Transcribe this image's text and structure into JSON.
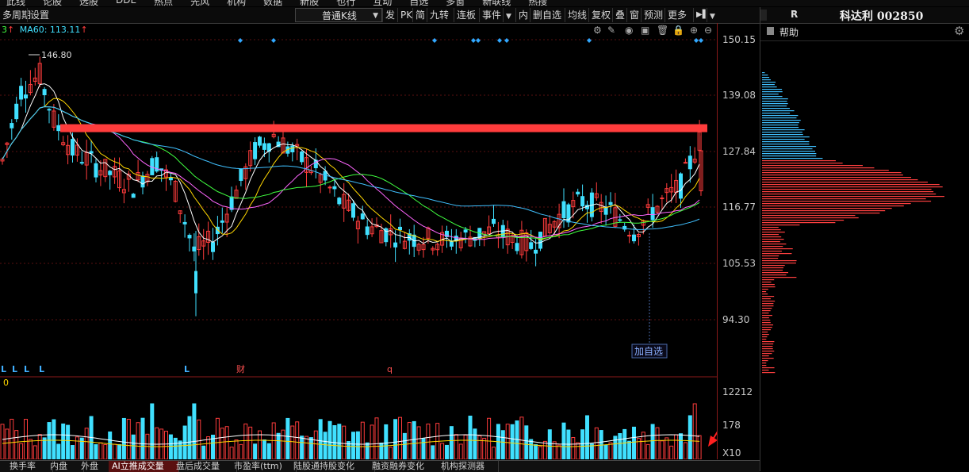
{
  "top_menu": {
    "items": [
      "此线",
      "论股",
      "选股",
      "DDE",
      "热点",
      "先风",
      "机构",
      "数据",
      "新股",
      "也行",
      "互动",
      "自选",
      "多窗",
      "新联线",
      "热搜"
    ]
  },
  "toolbar": {
    "period": "多周期",
    "settings": "设置",
    "kline_type": "普通K线",
    "buttons": [
      "发",
      "PK",
      "简",
      "九转",
      "连板",
      "事件"
    ],
    "buttons2": [
      "内",
      "删自选",
      "均线",
      "复权",
      "叠",
      "窗",
      "预测",
      "更多"
    ]
  },
  "title": {
    "flag": "R",
    "stock": "科达利 002850"
  },
  "ma_legend": {
    "left_num": "3",
    "ma60": "MA60: 113.11"
  },
  "axis": {
    "prices": [
      "150.15",
      "139.08",
      "127.84",
      "116.77",
      "105.53",
      "94.30"
    ],
    "high_label": "146.80",
    "volumes": [
      "12212",
      "178",
      "X10"
    ],
    "volume_left": "0"
  },
  "markers": {
    "L": "L",
    "cai": "财",
    "q": "q",
    "add_watch": "加自选"
  },
  "side_panel": {
    "help": "帮助"
  },
  "bottom_tabs": [
    "换手率",
    "内盘",
    "外盘",
    "AI立推成交量",
    "盘后成交量",
    "市盈率(ttm)",
    "陆股通持股变化",
    "融资融券变化",
    "机构探测器"
  ],
  "colors": {
    "up": "#ff3c3c",
    "down": "#40e0ff",
    "resistance": "#ff3c3c"
  },
  "chart_data": {
    "type": "candlestick",
    "price_axis": [
      94.3,
      105.53,
      116.77,
      127.84,
      139.08,
      150.15
    ],
    "resistance_level": 132.5,
    "max_price": 146.8,
    "volume_axis_max": 12212
  }
}
